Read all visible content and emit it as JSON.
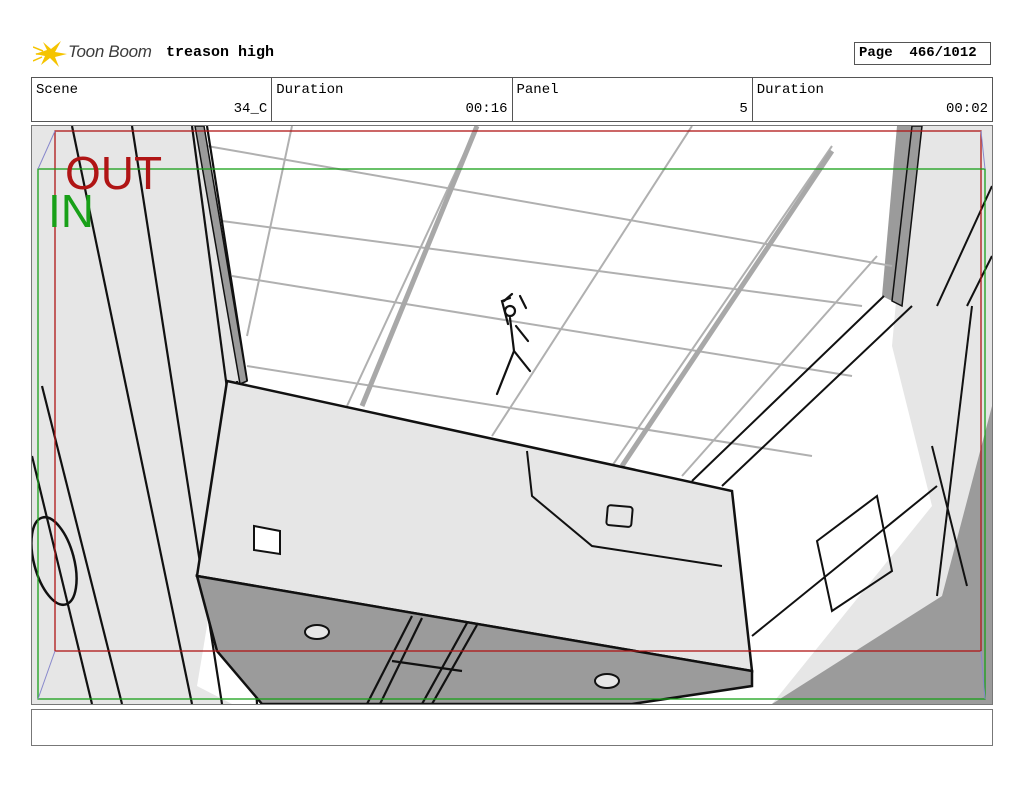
{
  "header": {
    "logo_text": "Toon Boom",
    "project_name": "treason high",
    "page_label": "Page",
    "page_value": "466/1012"
  },
  "info": [
    {
      "label": "Scene",
      "value": "34_C"
    },
    {
      "label": "Duration",
      "value": "00:16"
    },
    {
      "label": "Panel",
      "value": "5"
    },
    {
      "label": "Duration",
      "value": "00:02"
    }
  ],
  "panel": {
    "out_label": "OUT",
    "in_label": "IN",
    "out_color": "#b01515",
    "in_color": "#18a018"
  },
  "notes": {
    "text": ""
  },
  "colors": {
    "logo_star": "#f5c400",
    "frame_border": "#555555"
  }
}
